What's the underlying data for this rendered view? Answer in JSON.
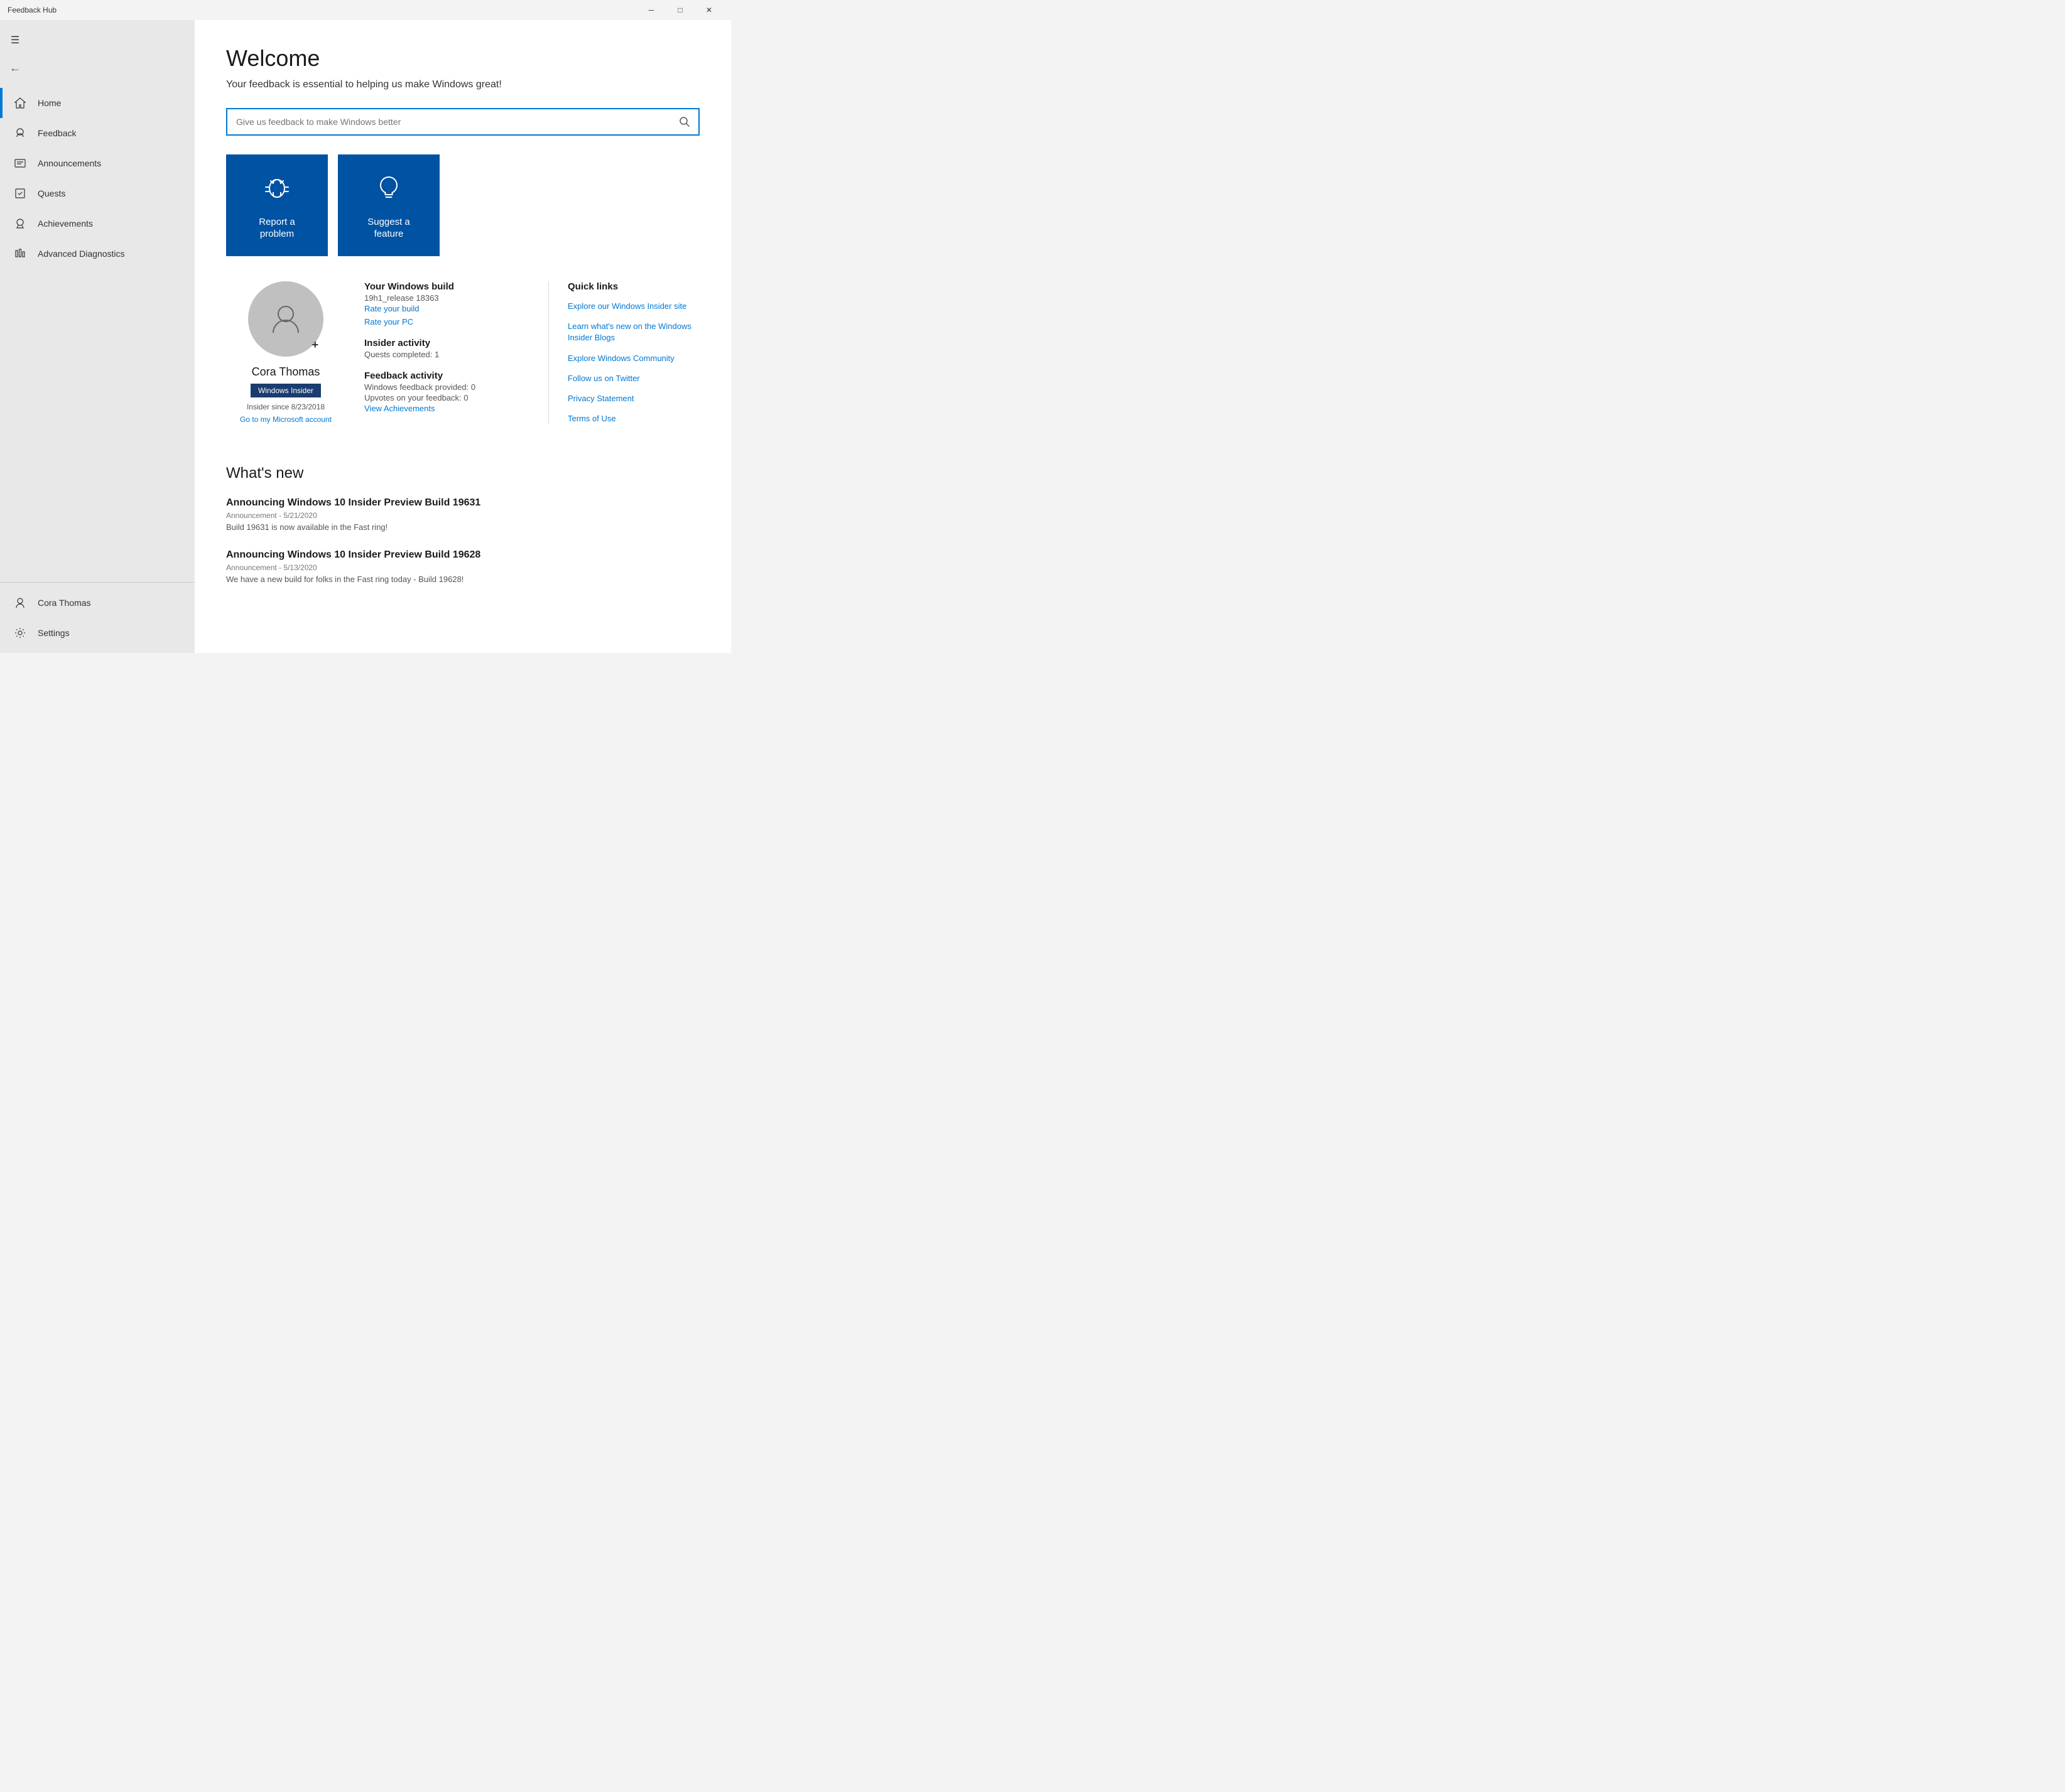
{
  "titleBar": {
    "title": "Feedback Hub",
    "minimizeLabel": "─",
    "maximizeLabel": "□",
    "closeLabel": "✕"
  },
  "sidebar": {
    "hamburgerLabel": "☰",
    "backLabel": "←",
    "navItems": [
      {
        "id": "home",
        "icon": "🏠",
        "label": "Home",
        "active": true
      },
      {
        "id": "feedback",
        "icon": "👤",
        "label": "Feedback",
        "active": false
      },
      {
        "id": "announcements",
        "icon": "📋",
        "label": "Announcements",
        "active": false
      },
      {
        "id": "quests",
        "icon": "🎯",
        "label": "Quests",
        "active": false
      },
      {
        "id": "achievements",
        "icon": "🏆",
        "label": "Achievements",
        "active": false
      },
      {
        "id": "advanced",
        "icon": "⚙",
        "label": "Advanced Diagnostics",
        "active": false
      }
    ],
    "bottomItems": [
      {
        "id": "user",
        "icon": "👤",
        "label": "Cora Thomas"
      },
      {
        "id": "settings",
        "icon": "⚙",
        "label": "Settings"
      }
    ]
  },
  "main": {
    "welcomeTitle": "Welcome",
    "welcomeSubtitle": "Your feedback is essential to helping us make Windows great!",
    "searchPlaceholder": "Give us feedback to make Windows better",
    "reportBtn": {
      "label": "Report a\nproblem"
    },
    "suggestBtn": {
      "label": "Suggest a\nfeature"
    },
    "userProfile": {
      "name": "Cora Thomas",
      "badgeLabel": "Windows Insider",
      "insiderSince": "Insider since 8/23/2018",
      "msAccountLink": "Go to my Microsoft account"
    },
    "windowsBuild": {
      "title": "Your Windows build",
      "value": "19h1_release 18363",
      "rateBuildLink": "Rate your build",
      "ratePCLink": "Rate your PC"
    },
    "insiderActivity": {
      "title": "Insider activity",
      "questsCompleted": "Quests completed: 1"
    },
    "feedbackActivity": {
      "title": "Feedback activity",
      "provided": "Windows feedback provided: 0",
      "upvotes": "Upvotes on your feedback: 0",
      "achievementsLink": "View Achievements"
    },
    "quickLinks": {
      "title": "Quick links",
      "links": [
        "Explore our Windows Insider site",
        "Learn what's new on the Windows Insider Blogs",
        "Explore Windows Community",
        "Follow us on Twitter",
        "Privacy Statement",
        "Terms of Use"
      ]
    },
    "whatsNew": {
      "title": "What's new",
      "items": [
        {
          "title": "Announcing Windows 10 Insider Preview Build 19631",
          "meta": "Announcement  -  5/21/2020",
          "desc": "Build 19631 is now available in the Fast ring!"
        },
        {
          "title": "Announcing Windows 10 Insider Preview Build 19628",
          "meta": "Announcement  -  5/13/2020",
          "desc": "We have a new build for folks in the Fast ring today - Build 19628!"
        }
      ]
    }
  }
}
